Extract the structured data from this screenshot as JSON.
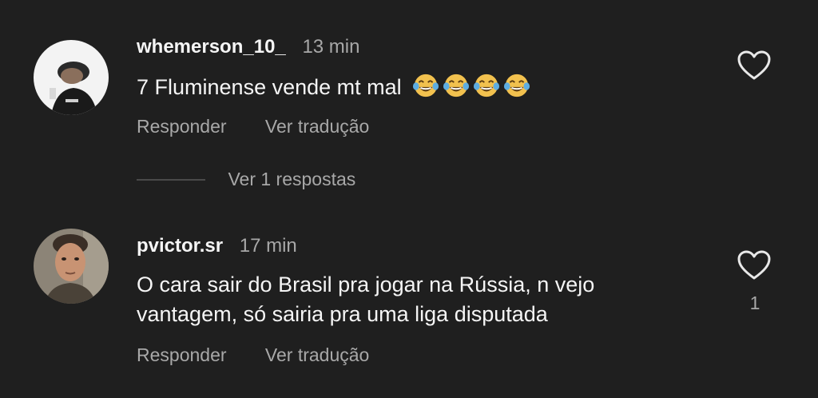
{
  "comments": [
    {
      "username": "whemerson_10_",
      "time": "13 min",
      "text": "7 Fluminense vende mt mal",
      "emoji": [
        "face-with-tears-of-joy",
        "face-with-tears-of-joy",
        "face-with-tears-of-joy",
        "face-with-tears-of-joy"
      ],
      "reply_label": "Responder",
      "translate_label": "Ver tradução",
      "view_replies_label": "Ver 1 respostas",
      "like_icon": "heart-outline-icon"
    },
    {
      "username": "pvictor.sr",
      "time": "17 min",
      "text": "O cara sair do Brasil pra jogar na Rússia, n vejo vantagem, só sairia pra uma liga disputada",
      "reply_label": "Responder",
      "translate_label": "Ver tradução",
      "like_icon": "heart-outline-icon",
      "like_count": "1"
    }
  ],
  "colors": {
    "background": "#1f1f1f",
    "primary_text": "#f5f5f5",
    "secondary_text": "#a8a8a8"
  }
}
